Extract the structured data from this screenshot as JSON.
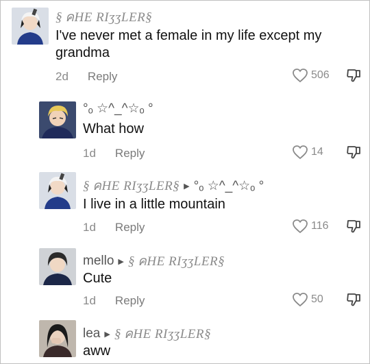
{
  "comments": [
    {
      "username": "§ คHE RIʒʒLER§",
      "text_lines": [
        "I've never met a female in my life except my",
        "grandma"
      ],
      "time": "2d",
      "reply_label": "Reply",
      "likes": "506"
    },
    {
      "username": "°ₒ ☆^_^☆ₒ °",
      "text_lines": [
        "What how"
      ],
      "time": "1d",
      "reply_label": "Reply",
      "likes": "14"
    },
    {
      "username": "§ คHE RIʒʒLER§",
      "reply_to": "°ₒ ☆^_^☆ₒ °",
      "text_lines": [
        "I live in a little mountain"
      ],
      "time": "1d",
      "reply_label": "Reply",
      "likes": "116"
    },
    {
      "username": "mello",
      "reply_to": "§ คHE RIʒʒLER§",
      "text_lines": [
        "Cute"
      ],
      "time": "1d",
      "reply_label": "Reply",
      "likes": "50"
    },
    {
      "username": "lea",
      "reply_to": "§ คHE RIʒʒLER§",
      "text_lines": [
        "aww"
      ]
    }
  ]
}
